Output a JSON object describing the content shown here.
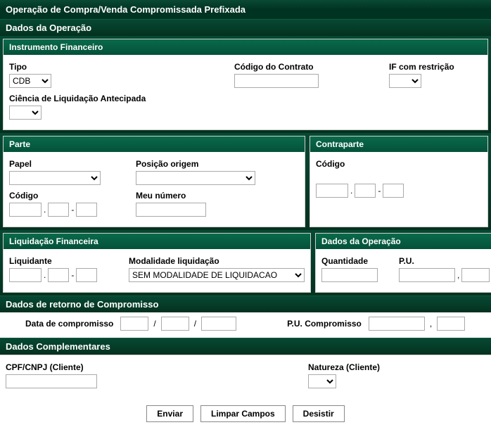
{
  "title": "Operação de Compra/Venda Compromissada Prefixada",
  "sections": {
    "dados_operacao_top": "Dados da Operação",
    "instrumento": "Instrumento Financeiro",
    "parte": "Parte",
    "contraparte": "Contraparte",
    "liquidacao": "Liquidação Financeira",
    "dados_operacao_right": "Dados da Operação",
    "retorno": "Dados de retorno de Compromisso",
    "complementares": "Dados Complementares"
  },
  "instrumento": {
    "tipo_label": "Tipo",
    "tipo_value": "CDB",
    "codigo_contrato_label": "Código do Contrato",
    "codigo_contrato_value": "",
    "if_restricao_label": "IF com restrição",
    "if_restricao_value": "",
    "ciencia_label": "Ciência de Liquidação Antecipada",
    "ciencia_value": ""
  },
  "parte": {
    "papel_label": "Papel",
    "papel_value": "",
    "posicao_label": "Posição origem",
    "posicao_value": "",
    "codigo_label": "Código",
    "codigo_a": "",
    "codigo_b": "",
    "codigo_c": "",
    "meu_numero_label": "Meu número",
    "meu_numero_value": ""
  },
  "contraparte": {
    "codigo_label": "Código",
    "codigo_a": "",
    "codigo_b": "",
    "codigo_c": ""
  },
  "liquidacao": {
    "liquidante_label": "Liquidante",
    "liquidante_a": "",
    "liquidante_b": "",
    "liquidante_c": "",
    "modalidade_label": "Modalidade liquidação",
    "modalidade_value": "SEM MODALIDADE DE LIQUIDACAO"
  },
  "dados_operacao": {
    "quantidade_label": "Quantidade",
    "quantidade_value": "",
    "pu_label": "P.U.",
    "pu_int": "",
    "pu_dec": ""
  },
  "retorno": {
    "data_label": "Data de compromisso",
    "data_d": "",
    "data_m": "",
    "data_y": "",
    "pu_label": "P.U. Compromisso",
    "pu_int": "",
    "pu_dec": ""
  },
  "complementares": {
    "cpf_label": "CPF/CNPJ (Cliente)",
    "cpf_value": "",
    "natureza_label": "Natureza (Cliente)",
    "natureza_value": ""
  },
  "buttons": {
    "enviar": "Enviar",
    "limpar": "Limpar Campos",
    "desistir": "Desistir"
  },
  "sep": {
    "dot": ".",
    "dash": "-",
    "comma": ",",
    "slash": "/"
  }
}
